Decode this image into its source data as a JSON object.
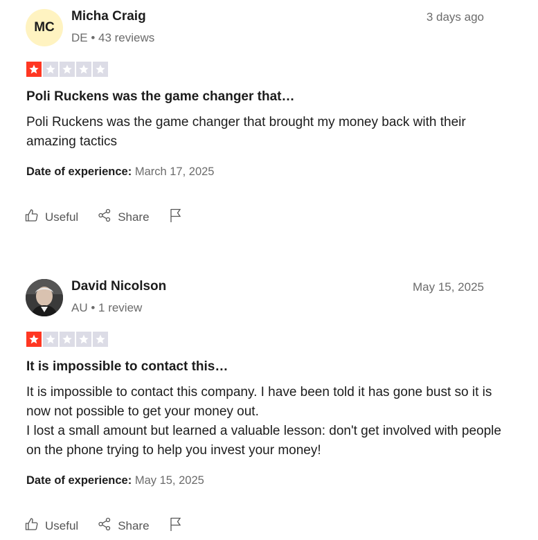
{
  "colors": {
    "star_filled": "#ff3722",
    "star_empty": "#dcdce6",
    "mc_avatar_bg": "#fff3c1"
  },
  "actions": {
    "useful": "Useful",
    "share": "Share"
  },
  "reviews": [
    {
      "initials": "MC",
      "name": "Micha Craig",
      "meta": "DE • 43 reviews",
      "date": "3 days ago",
      "rating": 1,
      "title": "Poli Ruckens was the game changer that…",
      "body": [
        "Poli Ruckens was the game changer that brought my money back with their amazing tactics"
      ],
      "experience_label": "Date of experience:",
      "experience_date": "March 17, 2025"
    },
    {
      "initials": "",
      "name": "David Nicolson",
      "meta": "AU • 1 review",
      "date": "May 15, 2025",
      "rating": 1,
      "title": "It is impossible to contact this…",
      "body": [
        "It is impossible to contact this company. I have been told it has gone bust so it is now not possible to get your money out.",
        "I lost a small amount but learned a valuable lesson: don't get involved with people on the phone trying to help you invest your money!"
      ],
      "experience_label": "Date of experience:",
      "experience_date": "May 15, 2025"
    }
  ]
}
